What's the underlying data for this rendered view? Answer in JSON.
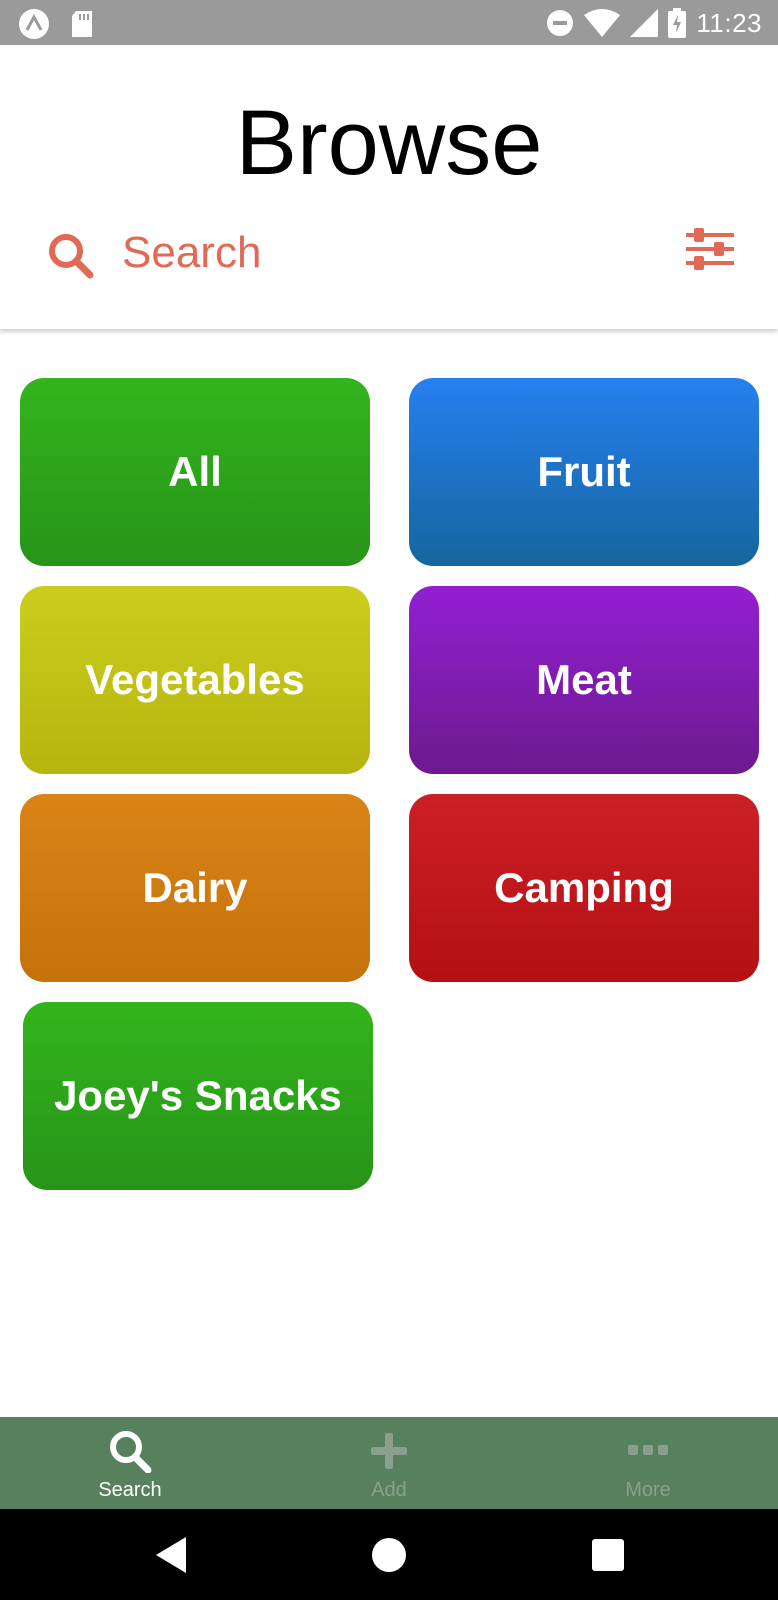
{
  "status_bar": {
    "time": "11:23",
    "icons": [
      "expo-icon",
      "sd-card-icon",
      "do-not-disturb-icon",
      "wifi-icon",
      "cell-signal-icon",
      "battery-charging-icon"
    ]
  },
  "header": {
    "title": "Browse",
    "search": {
      "placeholder": "Search",
      "value": ""
    },
    "filter_icon": "sliders-icon"
  },
  "categories": [
    {
      "label": "All",
      "color": "#2da51a"
    },
    {
      "label": "Fruit",
      "color": "#1f74d8"
    },
    {
      "label": "Vegetables",
      "color": "#c4c416"
    },
    {
      "label": "Meat",
      "color": "#801db3"
    },
    {
      "label": "Dairy",
      "color": "#d07c11"
    },
    {
      "label": "Camping",
      "color": "#c0171c"
    },
    {
      "label": "Joey's Snacks",
      "color": "#2da51a"
    }
  ],
  "tabbar": {
    "background": "#57805d",
    "tabs": [
      {
        "label": "Search",
        "icon": "search-icon",
        "active": true
      },
      {
        "label": "Add",
        "icon": "plus-icon",
        "active": false
      },
      {
        "label": "More",
        "icon": "more-icon",
        "active": false
      }
    ]
  },
  "accent_color": "#e06a55"
}
